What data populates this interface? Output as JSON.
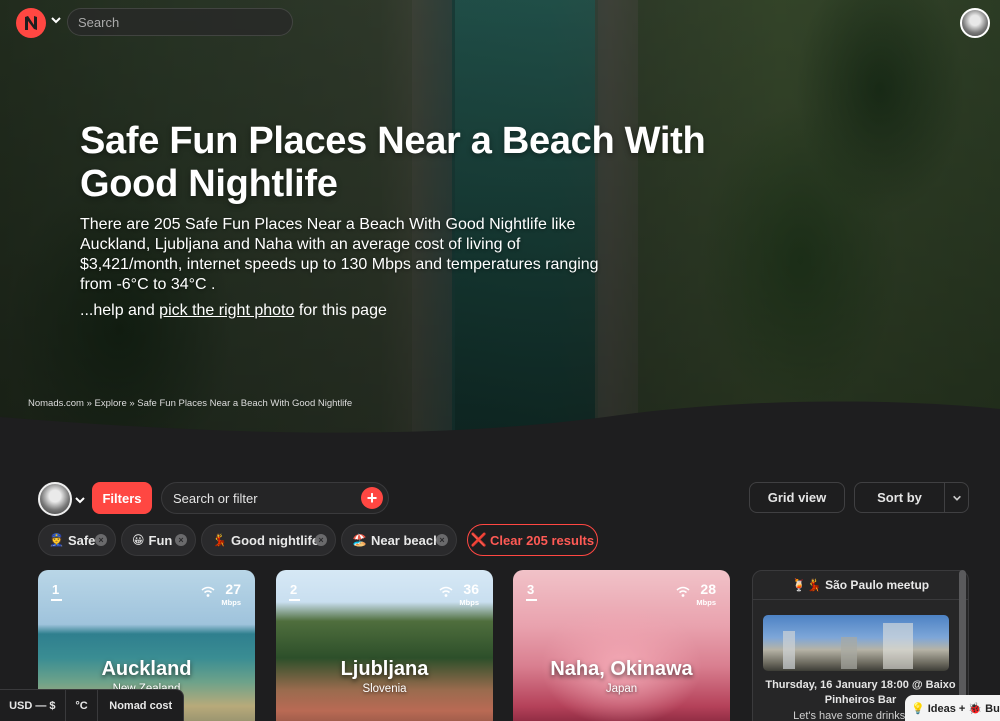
{
  "topbar": {
    "search_placeholder": "Search"
  },
  "hero": {
    "title": "Safe Fun Places Near a Beach With Good Nightlife",
    "description": "There are 205 Safe Fun Places Near a Beach With Good Nightlife like Auckland, Ljubljana and Naha with an average cost of living of $3,421/month, internet speeds up to 130 Mbps and temperatures ranging from -6°C to 34°C .",
    "help_prefix": "...help and ",
    "help_link": "pick the right photo",
    "help_suffix": " for this page",
    "breadcrumb": "Nomads.com » Explore » Safe Fun Places Near a Beach With Good Nightlife"
  },
  "filters": {
    "filters_label": "Filters",
    "search_placeholder": "Search or filter",
    "plus": "+",
    "grid_view_label": "Grid view",
    "sort_label": "Sort by",
    "tags": [
      {
        "emoji": "👮",
        "label": "Safe"
      },
      {
        "emoji": "😀",
        "label": "Fun"
      },
      {
        "emoji": "💃",
        "label": "Good nightlife"
      },
      {
        "emoji": "🏖️",
        "label": "Near beach"
      }
    ],
    "clear_icon": "❌",
    "clear_label": "Clear 205 results"
  },
  "cards": [
    {
      "rank": "1",
      "speed": "27",
      "unit": "Mbps",
      "city": "Auckland",
      "country": "New Zealand"
    },
    {
      "rank": "2",
      "speed": "36",
      "unit": "Mbps",
      "city": "Ljubljana",
      "country": "Slovenia"
    },
    {
      "rank": "3",
      "speed": "28",
      "unit": "Mbps",
      "city": "Naha, Okinawa",
      "country": "Japan"
    }
  ],
  "meetup": {
    "title": "🍹💃 São Paulo meetup",
    "date": "Thursday, 16 January 18:00 @ Baixo Pinheiros Bar",
    "subtitle": "Let's have some drinks with"
  },
  "bottombar": {
    "currency": "USD — $",
    "temp": "°C",
    "cost": "Nomad cost"
  },
  "ideas": {
    "label": "💡 Ideas + 🐞 Bugs"
  },
  "colors": {
    "accent": "#ff4742",
    "background": "#1e1e1f"
  },
  "icons": [
    "logo-icon",
    "chevron-down-icon",
    "close-icon",
    "plus-icon",
    "wifi-icon"
  ]
}
